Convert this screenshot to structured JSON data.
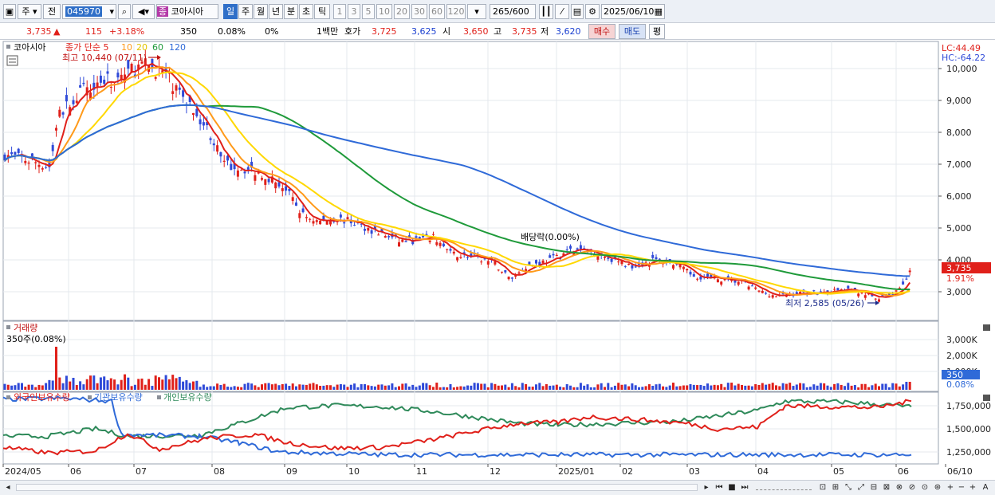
{
  "toolbar": {
    "period_type": "주",
    "prev_label": "전",
    "code": "045970",
    "sector_badge": "종",
    "stock_name": "코아시아",
    "periods": [
      "일",
      "주",
      "월",
      "년",
      "분",
      "초",
      "틱"
    ],
    "intervals": [
      "1",
      "3",
      "5",
      "10",
      "20",
      "30",
      "60",
      "120"
    ],
    "count": "265",
    "count_total": "/600",
    "date": "2025/06/10"
  },
  "quote": {
    "price": "3,735",
    "arrow": "▲",
    "change": "115",
    "change_pct": "+3.18%",
    "volume": "350",
    "volume_pct": "0.08%",
    "zero_pct": "0%",
    "unit": "1백만",
    "hoga_label": "호가",
    "ask": "3,725",
    "bid": "3,625",
    "open_label": "시",
    "open": "3,650",
    "high_label": "고",
    "high": "3,735",
    "low_label": "저",
    "low": "3,620",
    "buy_button": "매수",
    "sell_button": "매도",
    "avg_button": "평"
  },
  "price_pane": {
    "stock_tag": "코아시아",
    "legend_prefix": "종가 단순 5",
    "ma_periods": [
      "10",
      "20",
      "60",
      "120"
    ],
    "ma_colors": [
      "#e0201a",
      "#ff9a1a",
      "#ffd800",
      "#1f9a3a",
      "#2f6ad8"
    ],
    "high_note": "최고 10,440 (07/11)",
    "low_note": "최저 2,585 (05/26)",
    "dividend_note": "배당락(0.00%)",
    "lc": "LC:44.49",
    "hc": "HC:-64.22",
    "y_ticks": [
      "10,000",
      "9,000",
      "8,000",
      "7,000",
      "6,000",
      "5,000",
      "4,000",
      "3,000"
    ],
    "current_price_tag": "3,735",
    "current_pct_tag": "1.91%"
  },
  "volume_pane": {
    "title": "거래량",
    "note": "350주(0.08%)",
    "y_ticks": [
      "3,000K",
      "2,000K",
      "1,000K"
    ],
    "current_tag": "350",
    "current_pct": "0.08%"
  },
  "holding_pane": {
    "legend": [
      "외국인보유수량",
      "기관보유수량",
      "개인보유수량"
    ],
    "colors": [
      "#e0201a",
      "#2f6ad8",
      "#2f8a5a"
    ],
    "y_ticks": [
      "1,750,000",
      "1,500,000",
      "1,250,000"
    ]
  },
  "x_axis": [
    "2024/05",
    "06",
    "07",
    "08",
    "09",
    "10",
    "11",
    "12",
    "2025/01",
    "02",
    "03",
    "04",
    "05",
    "06",
    "06/10"
  ],
  "chart_data": {
    "type": "line",
    "x": [
      "2024/05",
      "06",
      "07",
      "08",
      "09",
      "10",
      "11",
      "12",
      "2025/01",
      "02",
      "03",
      "04",
      "05",
      "06"
    ],
    "series": [],
    "ylim": [
      2500,
      10500
    ]
  }
}
